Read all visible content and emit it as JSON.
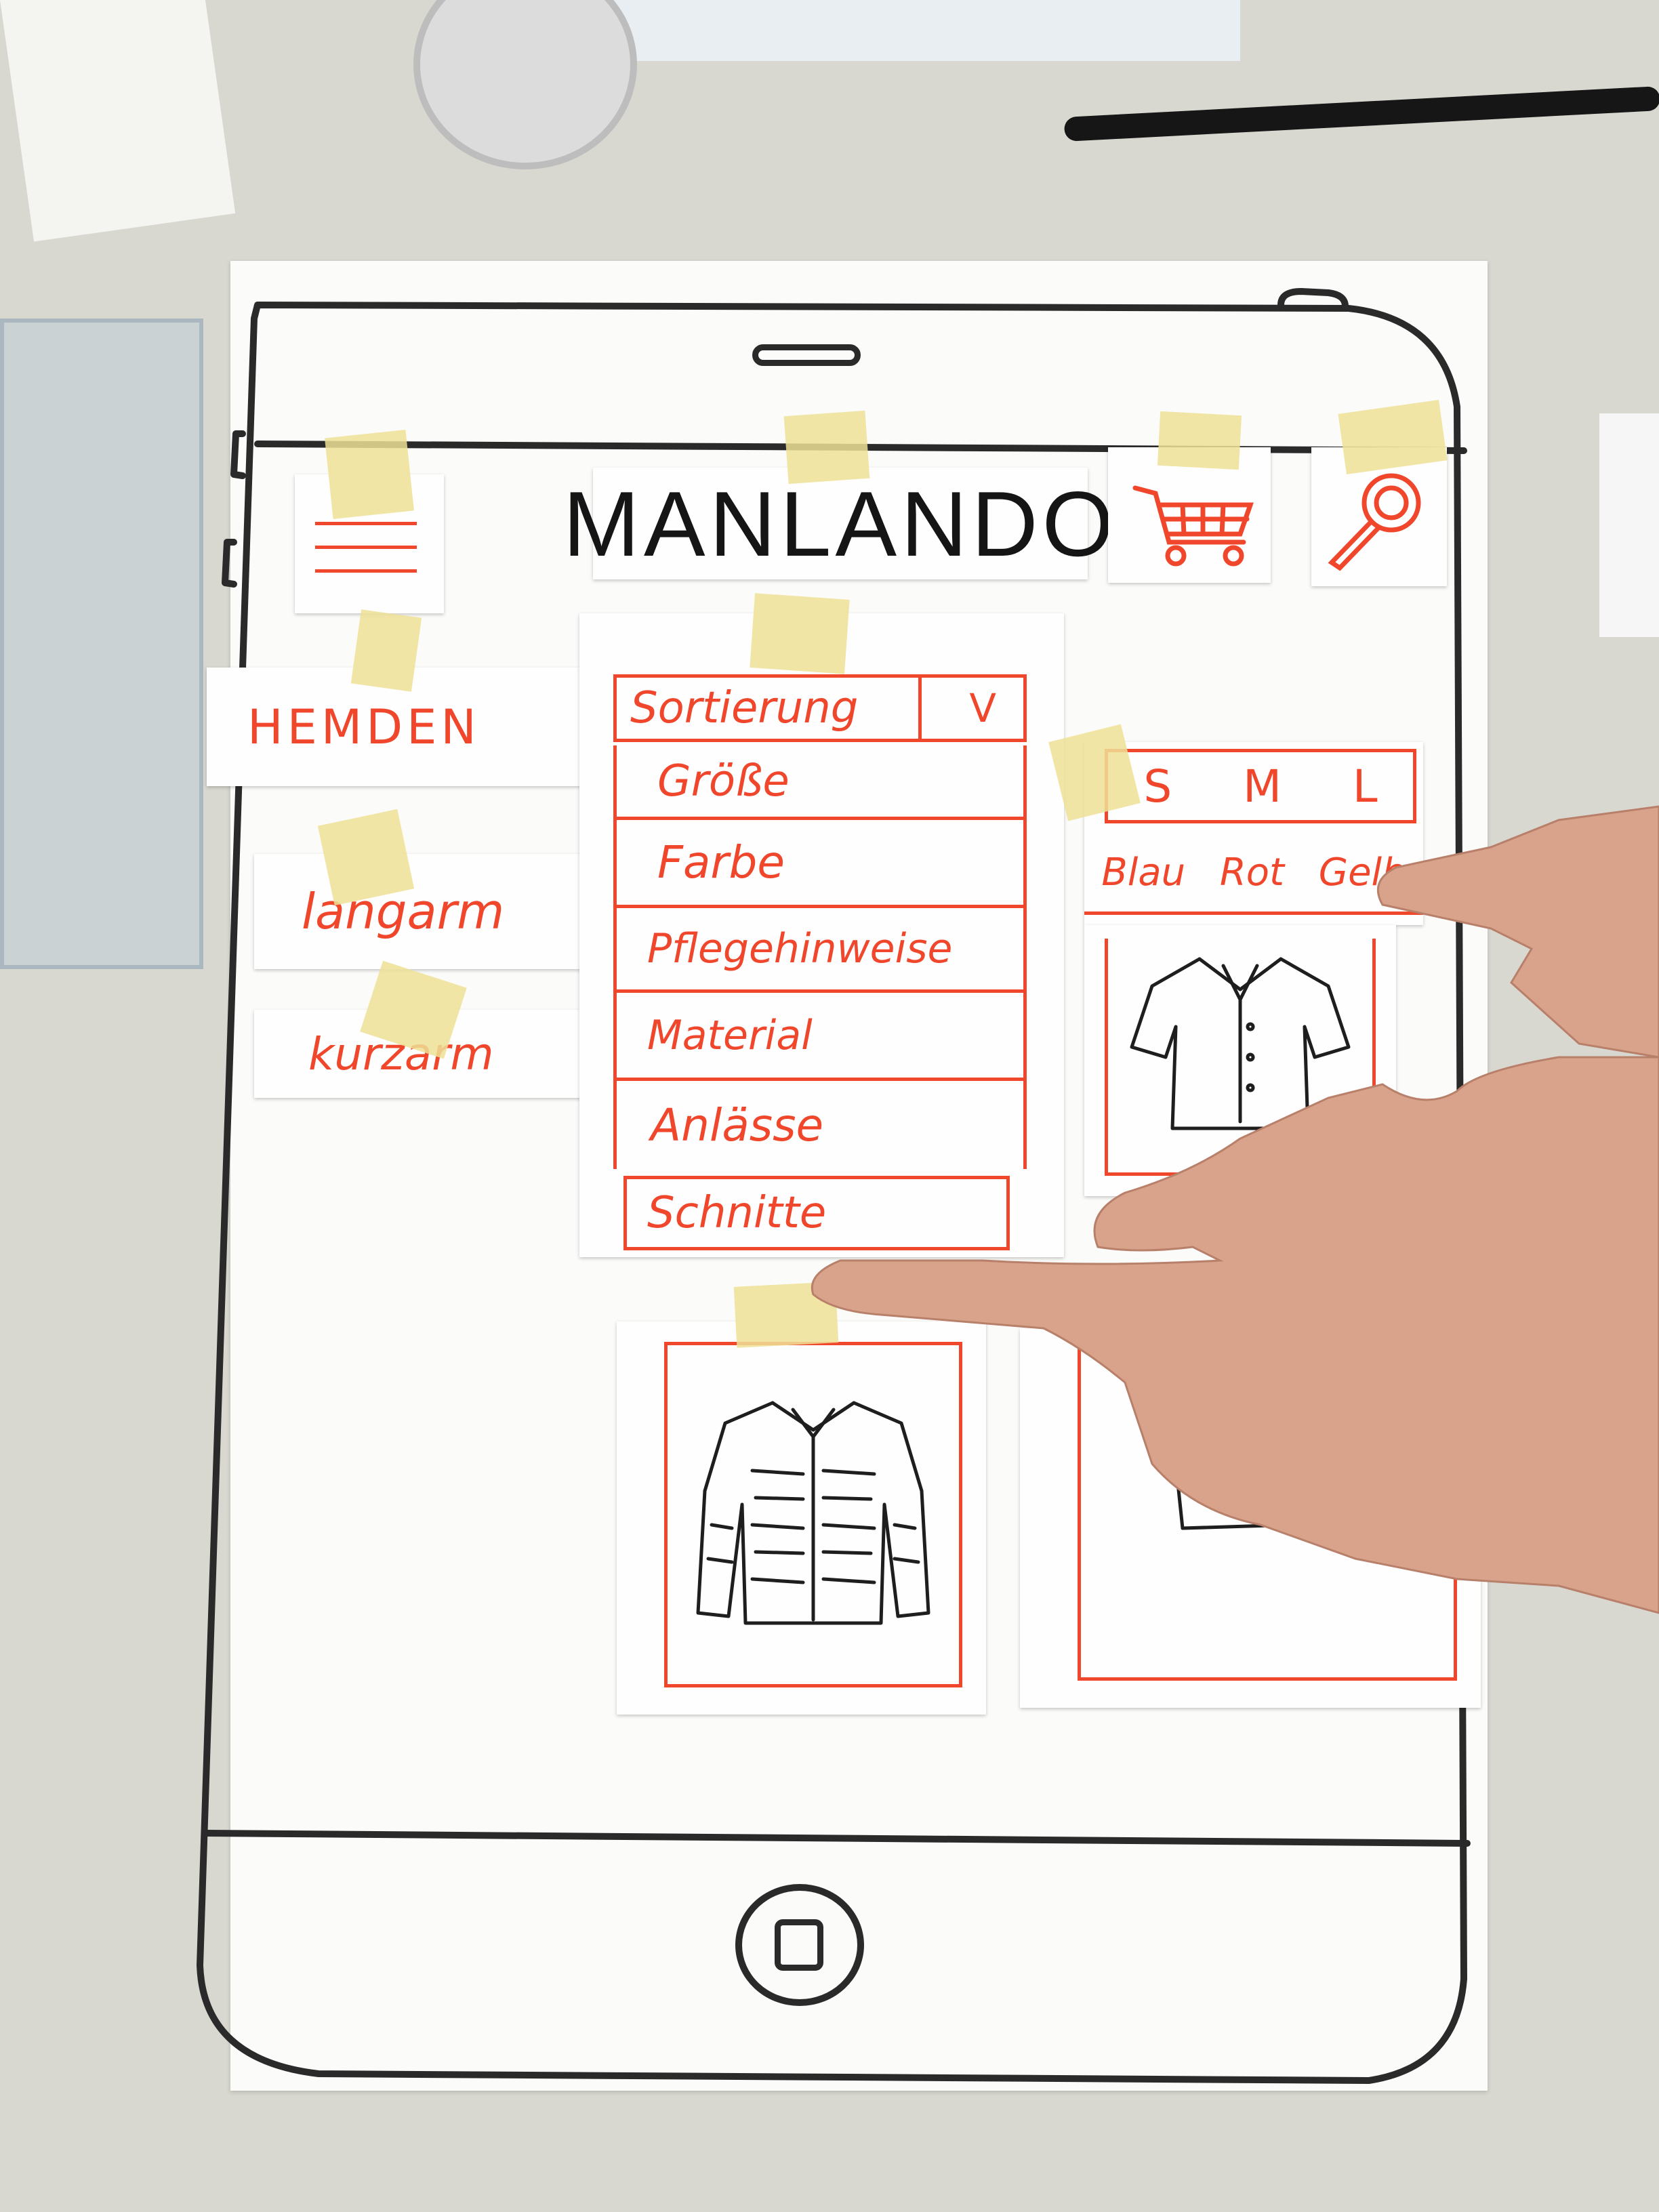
{
  "app": {
    "logo": "MANLANDO"
  },
  "header": {
    "menu_icon": "hamburger-menu-icon",
    "cart_icon": "shopping-cart-icon",
    "search_icon": "magnifier-search-icon"
  },
  "categories": {
    "main": "HEMDEN",
    "sub": [
      "langarm",
      "kurzarm"
    ]
  },
  "filter": {
    "sort_label": "Sortierung",
    "sort_toggle": "V",
    "items": [
      "Größe",
      "Farbe",
      "Pflegehinweise",
      "Material",
      "Anlässe",
      "Schnitte"
    ]
  },
  "size_filter": {
    "sizes": [
      "S",
      "M",
      "L"
    ],
    "colors": [
      "Blau",
      "Rot",
      "Gelb"
    ]
  },
  "products": [
    {
      "icon": "shirt-short-sleeve-icon"
    },
    {
      "icon": "shirt-long-sleeve-icon"
    },
    {
      "icon": "shirt-folded-icon"
    }
  ],
  "device": {
    "home_button_icon": "home-button-icon",
    "speaker_icon": "speaker-slot-icon"
  },
  "colors": {
    "accent": "#f0472c",
    "ink": "#2a2a2a",
    "tape": "#eee096",
    "paper": "#fbfbf9"
  }
}
